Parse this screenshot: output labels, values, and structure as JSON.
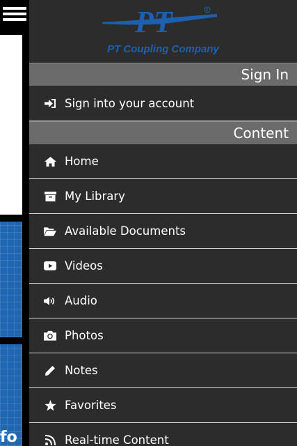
{
  "background_text": {
    "fragment": "fo"
  },
  "logo": {
    "monogram": "PT",
    "company": "PT Coupling Company",
    "brand_color": "#1f5fb0"
  },
  "sections": {
    "sign_in": "Sign In",
    "content": "Content"
  },
  "sign_in_items": [
    {
      "label": "Sign into your account",
      "icon": "sign-in-icon"
    }
  ],
  "content_items": [
    {
      "label": "Home",
      "icon": "home-icon"
    },
    {
      "label": "My Library",
      "icon": "archive-icon"
    },
    {
      "label": "Available Documents",
      "icon": "folder-open-icon"
    },
    {
      "label": "Videos",
      "icon": "video-play-icon"
    },
    {
      "label": "Audio",
      "icon": "speaker-icon"
    },
    {
      "label": "Photos",
      "icon": "camera-icon"
    },
    {
      "label": "Notes",
      "icon": "pencil-icon"
    },
    {
      "label": "Favorites",
      "icon": "star-icon"
    },
    {
      "label": "Real-time Content",
      "icon": "rss-icon"
    }
  ]
}
